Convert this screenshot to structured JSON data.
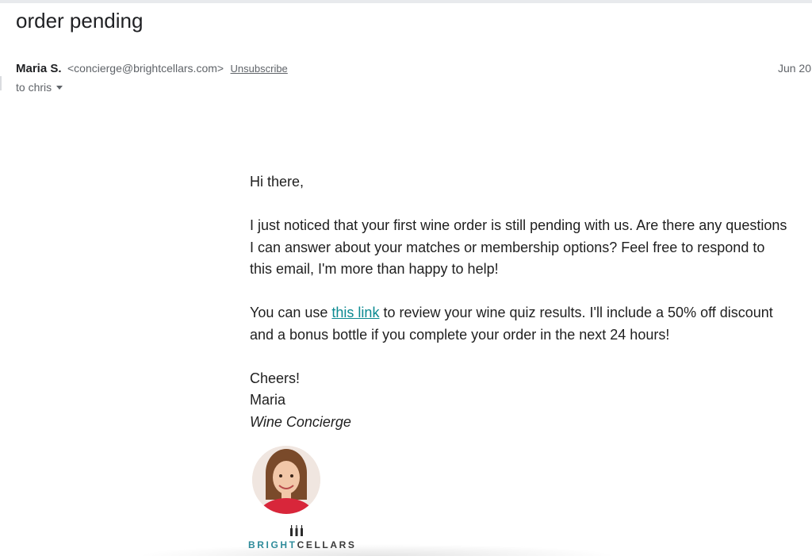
{
  "email": {
    "subject": "order pending",
    "sender": {
      "name": "Maria S.",
      "email": "<concierge@brightcellars.com>",
      "unsubscribe_label": "Unsubscribe"
    },
    "date": "Jun 20",
    "recipient": "to chris",
    "body": {
      "greeting": "Hi there,",
      "paragraph_1": "I just noticed that your first wine order is still pending with us. Are there any questions I can answer about your matches or membership options? Feel free to respond to this email, I'm more than happy to help!",
      "paragraph_2_before_link": "You can use ",
      "paragraph_2_link": "this link",
      "paragraph_2_after_link": " to review your wine quiz results. I'll include a 50% off discount and a bonus bottle if you complete your order in the next 24 hours!",
      "signoff": "Cheers!",
      "signature_name": "Maria",
      "signature_title": "Wine Concierge"
    },
    "logo": {
      "part_1": "BRIGHT",
      "part_2": "CELLARS"
    }
  },
  "colors": {
    "link": "#0b8a91",
    "brand_teal": "#2e8b9a",
    "brand_dark": "#3a3a3a"
  },
  "icons": {
    "recipient_dropdown": "caret-down-icon",
    "logo_mark": "wine-bottles-icon"
  }
}
